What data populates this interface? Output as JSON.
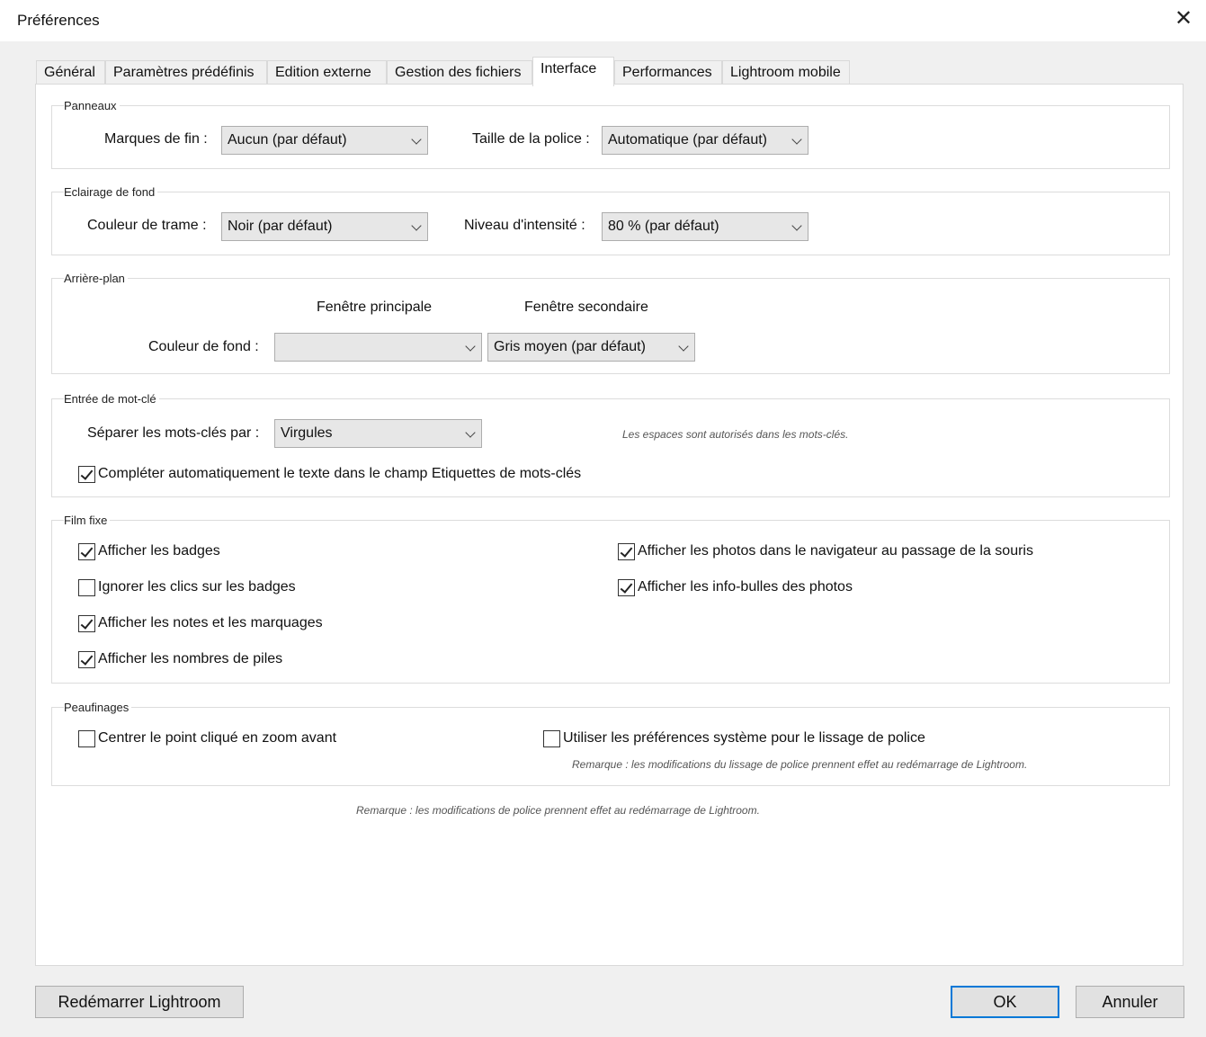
{
  "window": {
    "title": "Préférences",
    "close_symbol": "✕"
  },
  "tabs": [
    {
      "label": "Général"
    },
    {
      "label": "Paramètres prédéfinis"
    },
    {
      "label": "Edition externe"
    },
    {
      "label": "Gestion des fichiers"
    },
    {
      "label": "Interface",
      "active": true
    },
    {
      "label": "Performances"
    },
    {
      "label": "Lightroom mobile"
    }
  ],
  "panneaux": {
    "legend": "Panneaux",
    "fin_label": "Marques de fin :",
    "fin_value": "Aucun (par défaut)",
    "police_label": "Taille de la police :",
    "police_value": "Automatique (par défaut)"
  },
  "eclairage": {
    "legend": "Eclairage de fond",
    "trame_label": "Couleur de trame :",
    "trame_value": "Noir (par défaut)",
    "intensite_label": "Niveau d'intensité :",
    "intensite_value": "80 % (par défaut)"
  },
  "arriere_plan": {
    "legend": "Arrière-plan",
    "principale_header": "Fenêtre principale",
    "secondaire_header": "Fenêtre secondaire",
    "fond_label": "Couleur de fond :",
    "principale_value": "",
    "secondaire_value": "Gris moyen (par défaut)"
  },
  "mot_cle": {
    "legend": "Entrée de mot-clé",
    "separer_label": "Séparer les mots-clés par :",
    "separer_value": "Virgules",
    "note": "Les espaces sont autorisés dans les mots-clés.",
    "completer_label": "Compléter automatiquement le texte dans le champ Etiquettes de mots-clés",
    "completer_checked": true
  },
  "film_fixe": {
    "legend": "Film fixe",
    "badges": {
      "label": "Afficher les badges",
      "checked": true
    },
    "ignorer": {
      "label": "Ignorer les clics sur les badges",
      "checked": false
    },
    "notes": {
      "label": "Afficher les notes et les marquages",
      "checked": true
    },
    "piles": {
      "label": "Afficher les nombres de piles",
      "checked": true
    },
    "navigateur": {
      "label": "Afficher les photos dans le navigateur au passage de la souris",
      "checked": true
    },
    "infobulles": {
      "label": "Afficher les info-bulles des photos",
      "checked": true
    }
  },
  "peaufinages": {
    "legend": "Peaufinages",
    "centrer": {
      "label": "Centrer le point cliqué en zoom avant",
      "checked": false
    },
    "lissage": {
      "label": "Utiliser les préférences système pour le lissage de police",
      "checked": false
    },
    "lissage_note": "Remarque : les modifications du lissage de police prennent effet au redémarrage de Lightroom."
  },
  "footer_note": "Remarque : les modifications de police prennent effet au redémarrage de Lightroom.",
  "buttons": {
    "restart": "Redémarrer Lightroom",
    "ok": "OK",
    "cancel": "Annuler"
  }
}
